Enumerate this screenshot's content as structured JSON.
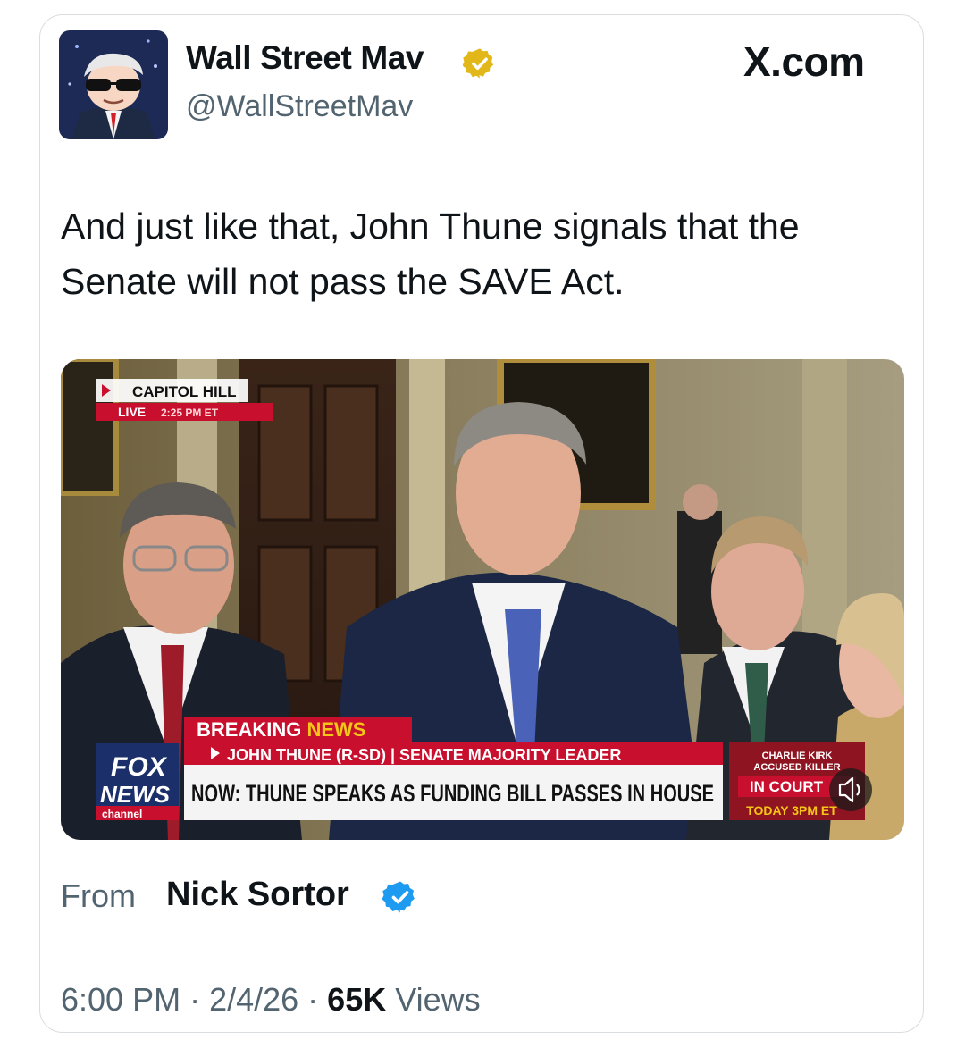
{
  "author": {
    "name": "Wall Street Mav",
    "handle": "@WallStreetMav",
    "verified_badge": "gold-check-icon",
    "avatar": "cartoon-avatar-sunglasses"
  },
  "source_logo": "X.com",
  "tweet_text": "And just like that, John Thune signals that the Senate will not pass the SAVE Act.",
  "media": {
    "location_label": "CAPITOL HILL",
    "live_label": "LIVE",
    "live_time": "2:25 PM ET",
    "breaking_label_1": "BREAKING ",
    "breaking_label_2": "NEWS",
    "speaker_line": "JOHN THUNE (R-SD) | SENATE MAJORITY LEADER",
    "headline": "NOW: THUNE SPEAKS AS FUNDING BILL PASSES IN HOUSE",
    "network_top": "FOX",
    "network_bottom": "NEWS",
    "network_channel": "channel",
    "promo_line1": "CHARLIE KIRK",
    "promo_line2": "ACCUSED KILLER",
    "promo_line3": "IN COURT",
    "promo_line4": "TODAY 3PM ET"
  },
  "attribution": {
    "from_label": "From",
    "from_name": "Nick Sortor",
    "verified_badge": "blue-check-icon"
  },
  "meta": {
    "time": "6:00 PM",
    "sep1": " · ",
    "date": "2/4/26",
    "sep2": " · ",
    "views_count": "65K",
    "views_label": " Views"
  },
  "colors": {
    "verified_gold": "#e2b719",
    "verified_blue": "#1d9bf0",
    "fox_red": "#c8102e",
    "fox_navy": "#1b2f6b"
  }
}
